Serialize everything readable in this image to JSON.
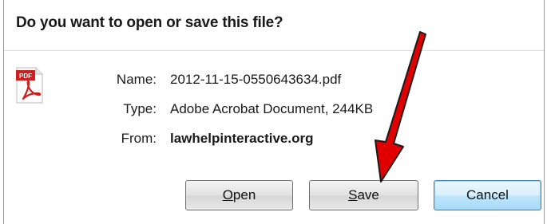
{
  "dialog": {
    "title": "Do you want to open or save this file?",
    "file_icon": {
      "name": "pdf-file-icon",
      "badge": "PDF",
      "accent": "#cc0000"
    },
    "rows": [
      {
        "label": "Name:",
        "value": "2012-11-15-0550643634.pdf"
      },
      {
        "label": "Type:",
        "value": "Adobe Acrobat Document, 244KB"
      },
      {
        "label": "From:",
        "value": "lawhelpinteractive.org"
      }
    ],
    "buttons": {
      "open": {
        "accel": "O",
        "rest": "pen"
      },
      "save": {
        "accel": "S",
        "rest": "ave"
      },
      "cancel": "Cancel"
    }
  },
  "colors": {
    "arrow": "#e00000",
    "focus_border": "#3c7fb1"
  }
}
